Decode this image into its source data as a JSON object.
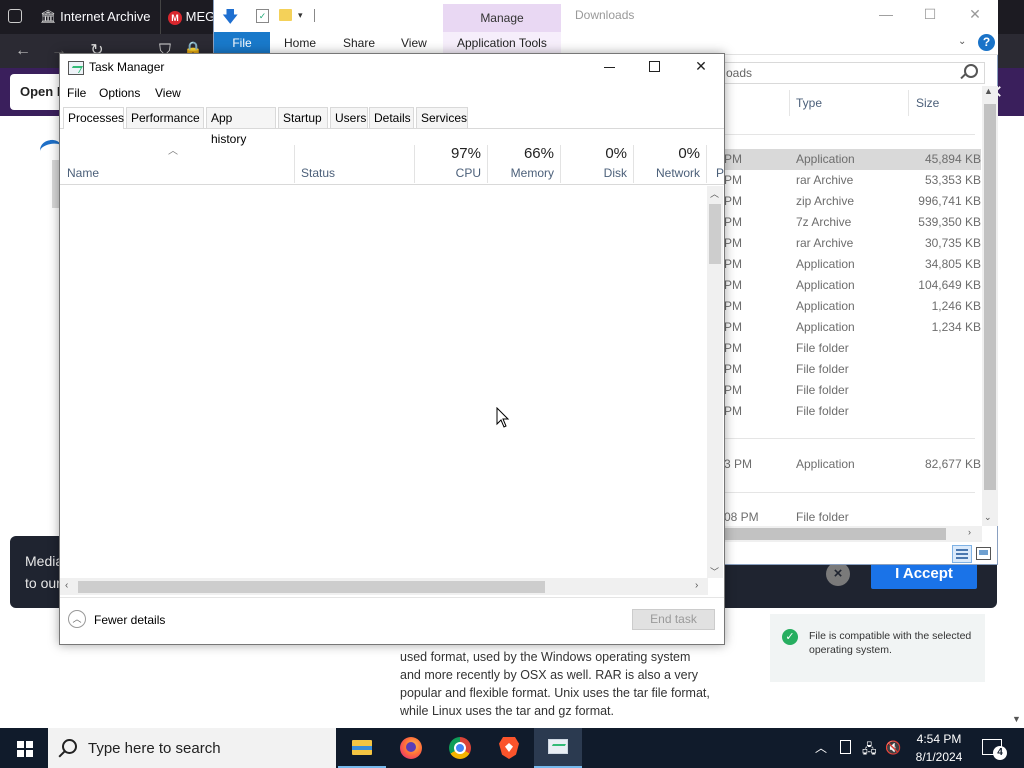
{
  "browser": {
    "tabs": [
      {
        "label": "Internet Archive"
      },
      {
        "label": "MEG"
      }
    ],
    "open_button": "Open F",
    "cookie_banner": {
      "line1": "Media",
      "line2": "to our",
      "accept": "I Accept",
      "close": "×"
    },
    "article": {
      "lines": [
        "used format, used by the Windows operating system",
        "and more recently by OSX as well. RAR is also a very",
        "popular and flexible format. Unix uses the tar file format,",
        "while Linux uses the tar and gz format."
      ]
    },
    "compat_message": "File is compatible with the selected operating system."
  },
  "explorer": {
    "title": "Downloads",
    "context_tab": "Manage",
    "ribbon_tabs": [
      "File",
      "Home",
      "Share",
      "View",
      "Application Tools"
    ],
    "search_text": "oads",
    "columns": {
      "type": "Type",
      "size": "Size"
    },
    "rows": [
      {
        "time": "PM",
        "type": "Application",
        "size": "45,894 KB",
        "selected": true
      },
      {
        "time": "PM",
        "type": "rar Archive",
        "size": "53,353 KB"
      },
      {
        "time": "PM",
        "type": "zip Archive",
        "size": "996,741 KB"
      },
      {
        "time": "PM",
        "type": "7z Archive",
        "size": "539,350 KB"
      },
      {
        "time": "PM",
        "type": "rar Archive",
        "size": "30,735 KB"
      },
      {
        "time": "PM",
        "type": "Application",
        "size": "34,805 KB"
      },
      {
        "time": "PM",
        "type": "Application",
        "size": "104,649 KB"
      },
      {
        "time": "PM",
        "type": "Application",
        "size": "1,246 KB"
      },
      {
        "time": "PM",
        "type": "Application",
        "size": "1,234 KB"
      },
      {
        "time": "PM",
        "type": "File folder",
        "size": ""
      },
      {
        "time": "PM",
        "type": "File folder",
        "size": ""
      },
      {
        "time": "PM",
        "type": "File folder",
        "size": ""
      },
      {
        "time": "PM",
        "type": "File folder",
        "size": ""
      }
    ],
    "group2_rows": [
      {
        "time": "3 PM",
        "type": "Application",
        "size": "82,677 KB"
      }
    ],
    "group3_rows": [
      {
        "time": "08 PM",
        "type": "File folder",
        "size": ""
      }
    ]
  },
  "task_manager": {
    "title": "Task Manager",
    "menu": [
      "File",
      "Options",
      "View"
    ],
    "tabs": [
      "Processes",
      "Performance",
      "App history",
      "Startup",
      "Users",
      "Details",
      "Services"
    ],
    "active_tab": "Processes",
    "columns": {
      "name": "Name",
      "status": "Status",
      "cpu": {
        "label": "CPU",
        "pct": "97%"
      },
      "memory": {
        "label": "Memory",
        "pct": "66%"
      },
      "disk": {
        "label": "Disk",
        "pct": "0%"
      },
      "network": {
        "label": "Network",
        "pct": "0%"
      },
      "power": {
        "label": "P"
      }
    },
    "fewer_details": "Fewer details",
    "end_task": "End task"
  },
  "taskbar": {
    "search_placeholder": "Type here to search",
    "apps": [
      "file-explorer-icon",
      "firefox-icon",
      "chrome-icon",
      "brave-icon",
      "task-manager-icon"
    ],
    "time": "4:54 PM",
    "date": "8/1/2024",
    "notification_count": "4"
  }
}
